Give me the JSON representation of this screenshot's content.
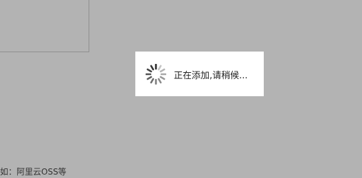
{
  "background": {
    "color": "#b3b3b3"
  },
  "footer": {
    "text": "如：阿里云OSS等"
  },
  "loading_dialog": {
    "message": "正在添加,请稍候...",
    "spinner_icon": "loading-spinner-icon"
  }
}
